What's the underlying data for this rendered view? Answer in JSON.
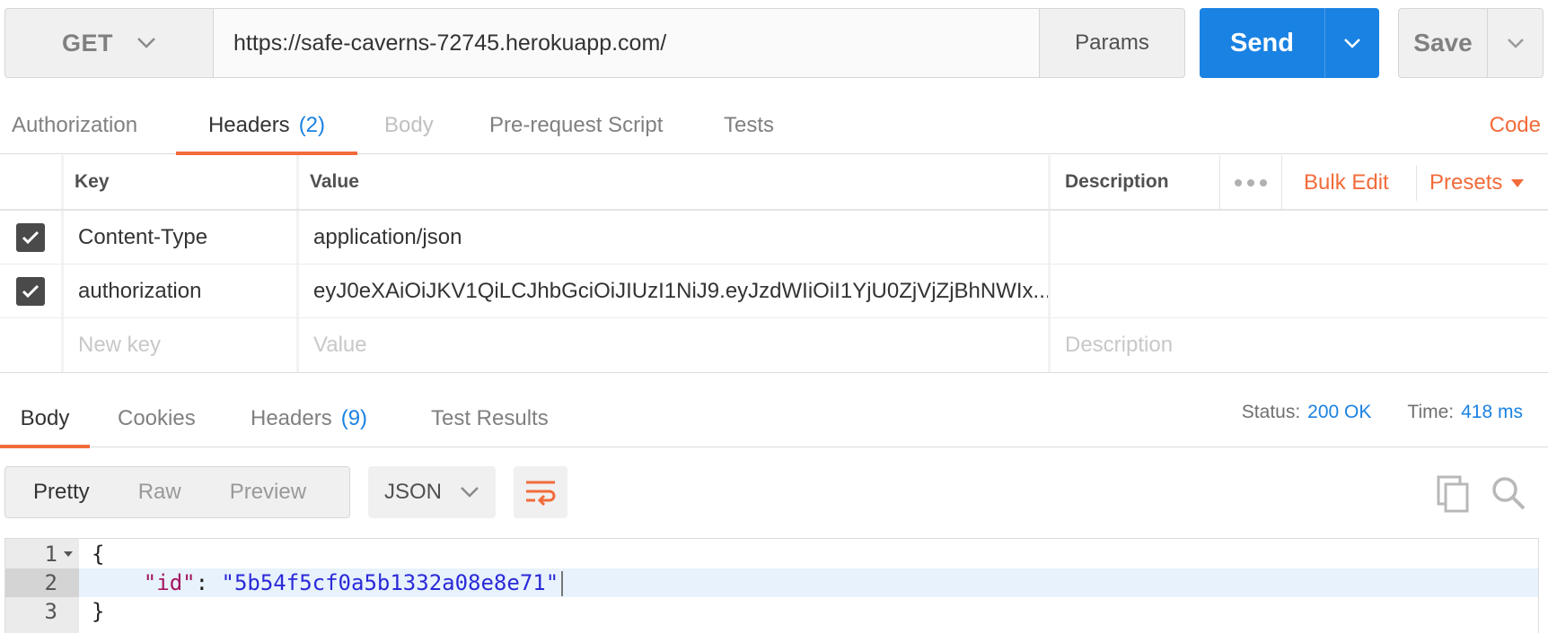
{
  "request": {
    "method": "GET",
    "url": "https://safe-caverns-72745.herokuapp.com/",
    "params_label": "Params",
    "send_label": "Send",
    "save_label": "Save"
  },
  "request_tabs": [
    {
      "label": "Authorization"
    },
    {
      "label": "Headers",
      "count": "(2)"
    },
    {
      "label": "Body"
    },
    {
      "label": "Pre-request Script"
    },
    {
      "label": "Tests"
    }
  ],
  "code_link": "Code",
  "headers_table": {
    "columns": {
      "key": "Key",
      "value": "Value",
      "description": "Description"
    },
    "bulk_edit": "Bulk Edit",
    "presets": "Presets",
    "rows": [
      {
        "checked": true,
        "key": "Content-Type",
        "value": "application/json",
        "description": ""
      },
      {
        "checked": true,
        "key": "authorization",
        "value": "eyJ0eXAiOiJKV1QiLCJhbGciOiJIUzI1NiJ9.eyJzdWIiOiI1YjU0ZjVjZjBhNWIx...",
        "description": ""
      }
    ],
    "new_row": {
      "key_placeholder": "New key",
      "value_placeholder": "Value",
      "description_placeholder": "Description"
    }
  },
  "response_tabs": [
    {
      "label": "Body"
    },
    {
      "label": "Cookies"
    },
    {
      "label": "Headers",
      "count": "(9)"
    },
    {
      "label": "Test Results"
    }
  ],
  "status": {
    "status_label": "Status:",
    "status_value": "200 OK",
    "time_label": "Time:",
    "time_value": "418 ms"
  },
  "view_modes": [
    "Pretty",
    "Raw",
    "Preview"
  ],
  "format": "JSON",
  "body_lines": [
    {
      "num": "1",
      "text": "{"
    },
    {
      "num": "2",
      "key": "\"id\"",
      "colon": ": ",
      "value": "\"5b54f5cf0a5b1332a08e8e71\""
    },
    {
      "num": "3",
      "text": "}"
    }
  ],
  "colors": {
    "accent_orange": "#f26b3a",
    "primary_blue": "#1a82e2"
  },
  "icons": [
    "chevron-down-icon",
    "checkbox-checked-icon",
    "more-dots-icon",
    "caret-down-icon",
    "wrap-lines-icon",
    "copy-icon",
    "search-icon",
    "fold-arrow-icon"
  ]
}
